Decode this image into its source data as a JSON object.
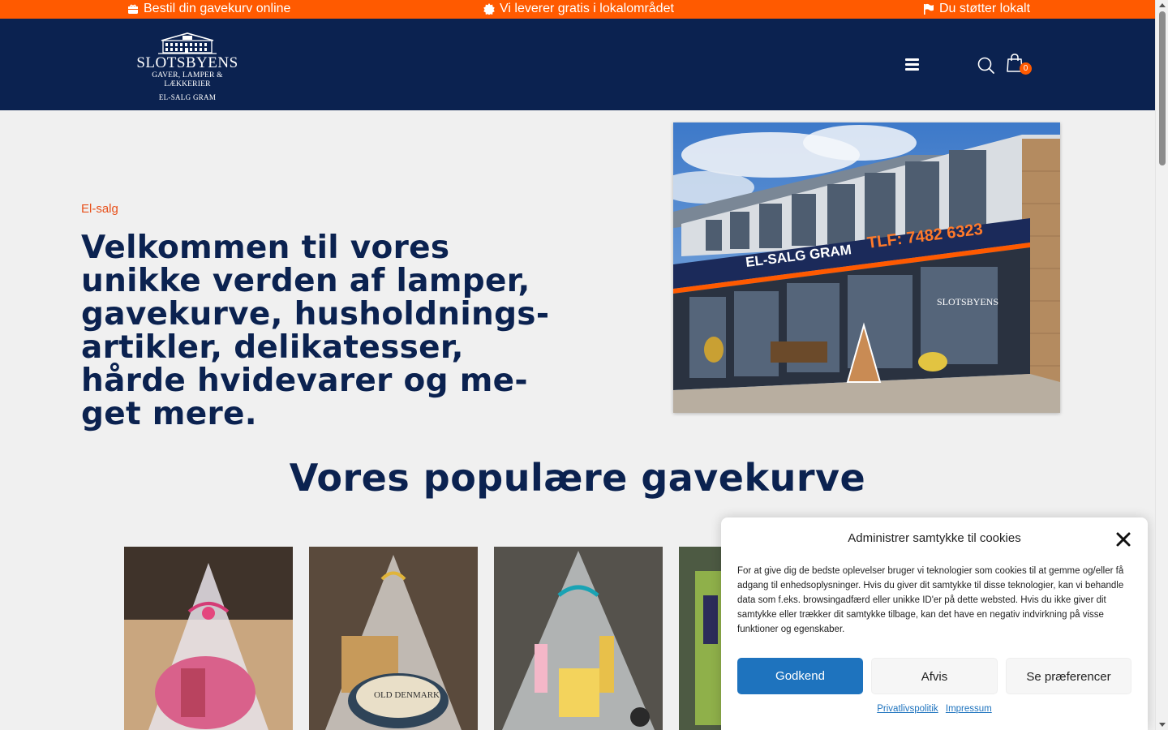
{
  "topbar": {
    "items": [
      {
        "icon": "gift-icon",
        "text": "Bestil din gavekurv online"
      },
      {
        "icon": "badge-icon",
        "text": "Vi leverer gratis i lokalområdet"
      },
      {
        "icon": "flag-icon",
        "text": "Du støtter lokalt"
      }
    ],
    "background": "#ff5a00"
  },
  "header": {
    "background": "#0b2250",
    "logo": {
      "line1": "SLOTSBYENS",
      "line2": "GAVER, LAMPER & LÆKKERIER",
      "line3": "EL-SALG GRAM"
    },
    "menu_icon": "hamburger-icon",
    "search_icon": "search-icon",
    "cart_icon": "shopping-bag-icon",
    "cart_count": "0"
  },
  "hero": {
    "eyebrow": "El-salg",
    "title": "Velkommen til vores unikke verden af lamper, gavekurve, husholdnings-artikler, delikatesser, hårde hvidevarer og me-get mere.",
    "image": {
      "sign_text": "EL-SALG GRAM",
      "phone_text": "TLF: 7482 6323",
      "window_text": "SLOTSBYENS"
    }
  },
  "section": {
    "title": "Vores populære gavekurve"
  },
  "products": [
    {
      "name": "gift-basket-pink"
    },
    {
      "name": "gift-basket-old-denmark",
      "label": "OLD DENMARK"
    },
    {
      "name": "gift-basket-teal"
    },
    {
      "name": "gift-basket-green"
    }
  ],
  "cookie": {
    "title": "Administrer samtykke til cookies",
    "text": "For at give dig de bedste oplevelser bruger vi teknologier som cookies til at gemme og/eller få adgang til enhedsoplysninger. Hvis du giver dit samtykke til disse teknologier, kan vi behandle data som f.eks. browsingadfærd eller unikke ID'er på dette websted. Hvis du ikke giver dit samtykke eller trækker dit samtykke tilbage, kan det have en negativ indvirkning på visse funktioner og egenskaber.",
    "accept_label": "Godkend",
    "deny_label": "Afvis",
    "prefs_label": "Se præferencer",
    "links": [
      "Privatlivspolitik",
      "Impressum"
    ],
    "accent": "#1e73be"
  }
}
